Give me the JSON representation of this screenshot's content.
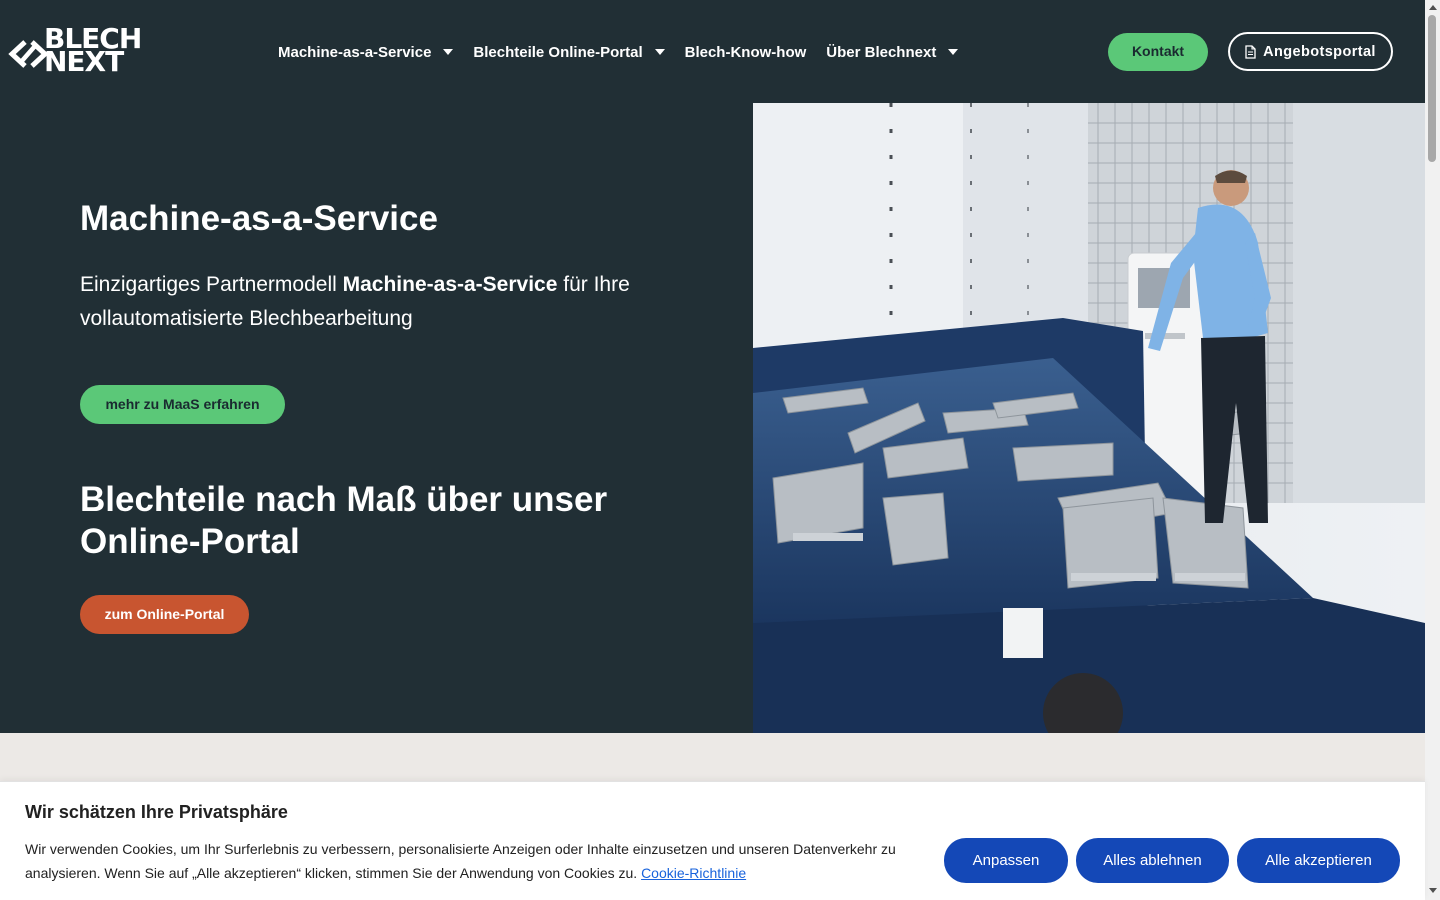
{
  "brand": {
    "line1": "BLECH",
    "line2": "NEXT"
  },
  "nav": [
    {
      "label": "Machine-as-a-Service",
      "dropdown": true
    },
    {
      "label": "Blechteile Online-Portal",
      "dropdown": true
    },
    {
      "label": "Blech-Know-how",
      "dropdown": false
    },
    {
      "label": "Über Blechnext",
      "dropdown": true
    }
  ],
  "header": {
    "contact_label": "Kontakt",
    "portal_label": "Angebotsportal"
  },
  "hero": {
    "title": "Machine-as-a-Service",
    "lead_pre": "Einzigartiges Partnermodell ",
    "lead_bold": "Machine-as-a-Service",
    "lead_post": " für Ihre vollautomatisierte Blechbearbeitung",
    "maas_button": "mehr zu MaaS erfahren",
    "title2": "Blechteile nach Maß über unser Online-Portal",
    "portal_button": "zum Online-Portal"
  },
  "cookie": {
    "title": "Wir schätzen Ihre Privatsphäre",
    "text": "Wir verwenden Cookies, um Ihr Surferlebnis zu verbessern, personalisierte Anzeigen oder Inhalte einzusetzen und unseren Datenverkehr zu analysieren. Wenn Sie auf „Alle akzeptieren“ klicken, stimmen Sie der Anwendung von Cookies zu. ",
    "link": "Cookie-Richtlinie",
    "customize": "Anpassen",
    "reject": "Alles ablehnen",
    "accept": "Alle akzeptieren"
  },
  "colors": {
    "header_bg": "#212f35",
    "accent_green": "#5bc878",
    "accent_orange": "#c85530",
    "cookie_blue": "#1448b7",
    "light_bg": "#ece9e6"
  }
}
